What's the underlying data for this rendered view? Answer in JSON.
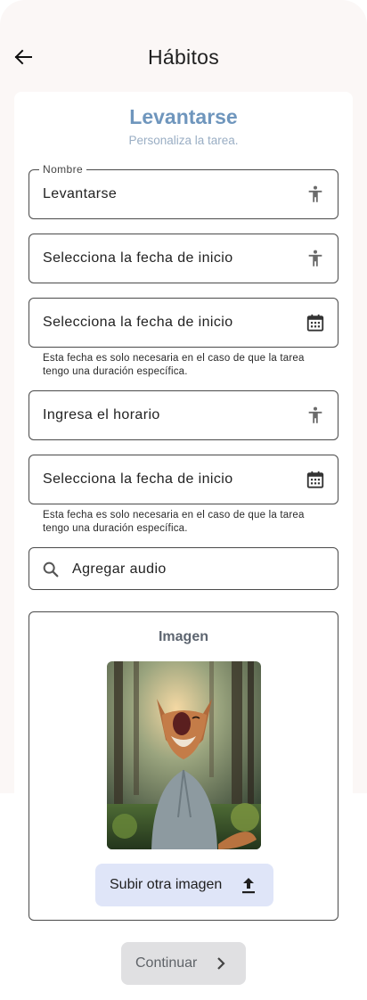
{
  "header": {
    "title": "Hábitos",
    "back_icon": "arrow-back-icon"
  },
  "task": {
    "title": "Levantarse",
    "subtitle": "Personaliza la tarea."
  },
  "fields": {
    "name": {
      "label": "Nombre",
      "value": "Levantarse",
      "icon": "accessibility-icon"
    },
    "start_date": {
      "value": "Selecciona la fecha de inicio",
      "icon": "accessibility-icon"
    },
    "date_1": {
      "value": "Selecciona la fecha de inicio",
      "icon": "calendar-icon",
      "helper": "Esta fecha es solo necesaria en el caso de que la tarea tengo una duración específica."
    },
    "schedule": {
      "value": "Ingresa el horario",
      "icon": "accessibility-icon"
    },
    "date_2": {
      "value": "Selecciona la fecha de inicio",
      "icon": "calendar-icon",
      "helper": "Esta fecha es solo necesaria en el caso de que la tarea tengo una duración específica."
    },
    "audio": {
      "placeholder": "Agregar audio",
      "icon": "search-icon"
    }
  },
  "image_section": {
    "label": "Imagen",
    "upload_label": "Subir otra imagen",
    "upload_icon": "upload-icon"
  },
  "continue": {
    "label": "Continuar",
    "icon": "chevron-right-icon"
  },
  "colors": {
    "accent_title": "#6f96bd",
    "upload_bg": "#dfe5f8",
    "continue_bg": "#e0e0e2"
  }
}
